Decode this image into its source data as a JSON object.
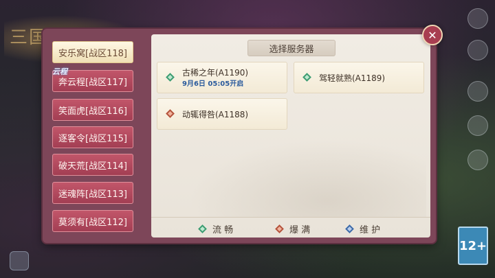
{
  "zones": [
    {
      "label": "安乐窝[战区118]",
      "active": true
    },
    {
      "label": "奔云程[战区117]"
    },
    {
      "label": "笑面虎[战区116]"
    },
    {
      "label": "逐客令[战区115]"
    },
    {
      "label": "破天荒[战区114]"
    },
    {
      "label": "迷魂阵[战区113]"
    },
    {
      "label": "莫须有[战区112]"
    }
  ],
  "cloud_tag": "云程",
  "panel_title": "选择服务器",
  "servers": [
    {
      "name": "古稀之年(A1190)",
      "time": "9月6日 05:05开启",
      "status": "green"
    },
    {
      "name": "驾轻就熟(A1189)",
      "status": "green"
    },
    {
      "name": "动辄得咎(A1188)",
      "status": "red"
    }
  ],
  "legend": [
    {
      "label": "流 畅",
      "color": "green"
    },
    {
      "label": "爆 满",
      "color": "red"
    },
    {
      "label": "维 护",
      "color": "blue"
    }
  ],
  "logo_text": "三国志 幻想大",
  "rating_label": "12+",
  "close_label": "✕",
  "arrow_glyph": "›",
  "colors": {
    "zone_active": "#fff4dc",
    "zone_normal": "#b44a5f",
    "status_green": "#3d9c72",
    "status_red": "#b4533c",
    "status_blue": "#3d6aa8"
  }
}
